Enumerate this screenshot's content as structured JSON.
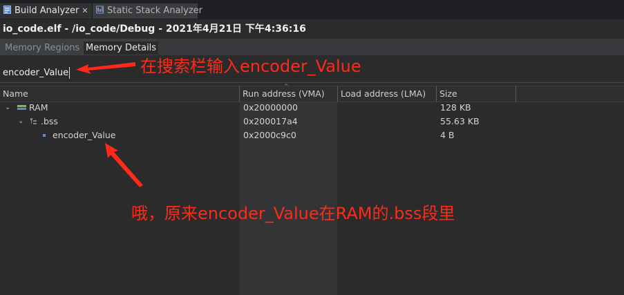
{
  "view_tabs": [
    {
      "label": "Build Analyzer",
      "close": "✕",
      "active": true,
      "icon": "build-analyzer-icon"
    },
    {
      "label": "Static Stack Analyzer",
      "active": false,
      "icon": "stack-analyzer-icon"
    }
  ],
  "title": "io_code.elf - /io_code/Debug - 2021年4月21日 下午4:36:16",
  "sub_tabs": [
    {
      "label": "Memory Regions",
      "active": false
    },
    {
      "label": "Memory Details",
      "active": true
    }
  ],
  "search": {
    "value": "encoder_Value"
  },
  "table": {
    "columns": [
      "Name",
      "Run address (VMA)",
      "Load address (LMA)",
      "Size"
    ],
    "rows": [
      {
        "name": "RAM",
        "run": "0x20000000",
        "load": "",
        "size": "128 KB",
        "level": 0,
        "expanded": true,
        "icon": "memory-region-icon"
      },
      {
        "name": ".bss",
        "run": "0x200017a4",
        "load": "",
        "size": "55.63 KB",
        "level": 1,
        "expanded": true,
        "icon": "section-icon"
      },
      {
        "name": "encoder_Value",
        "run": "0x2000c9c0",
        "load": "",
        "size": "4 B",
        "level": 2,
        "expanded": false,
        "icon": "symbol-icon"
      }
    ]
  },
  "annotations": {
    "search_hint": "在搜索栏输入encoder_Value",
    "result_hint": "哦，原来encoder_Value在RAM的.bss段里"
  },
  "colors": {
    "annotation": "#ff2a1a",
    "background": "#2b2b2b"
  }
}
